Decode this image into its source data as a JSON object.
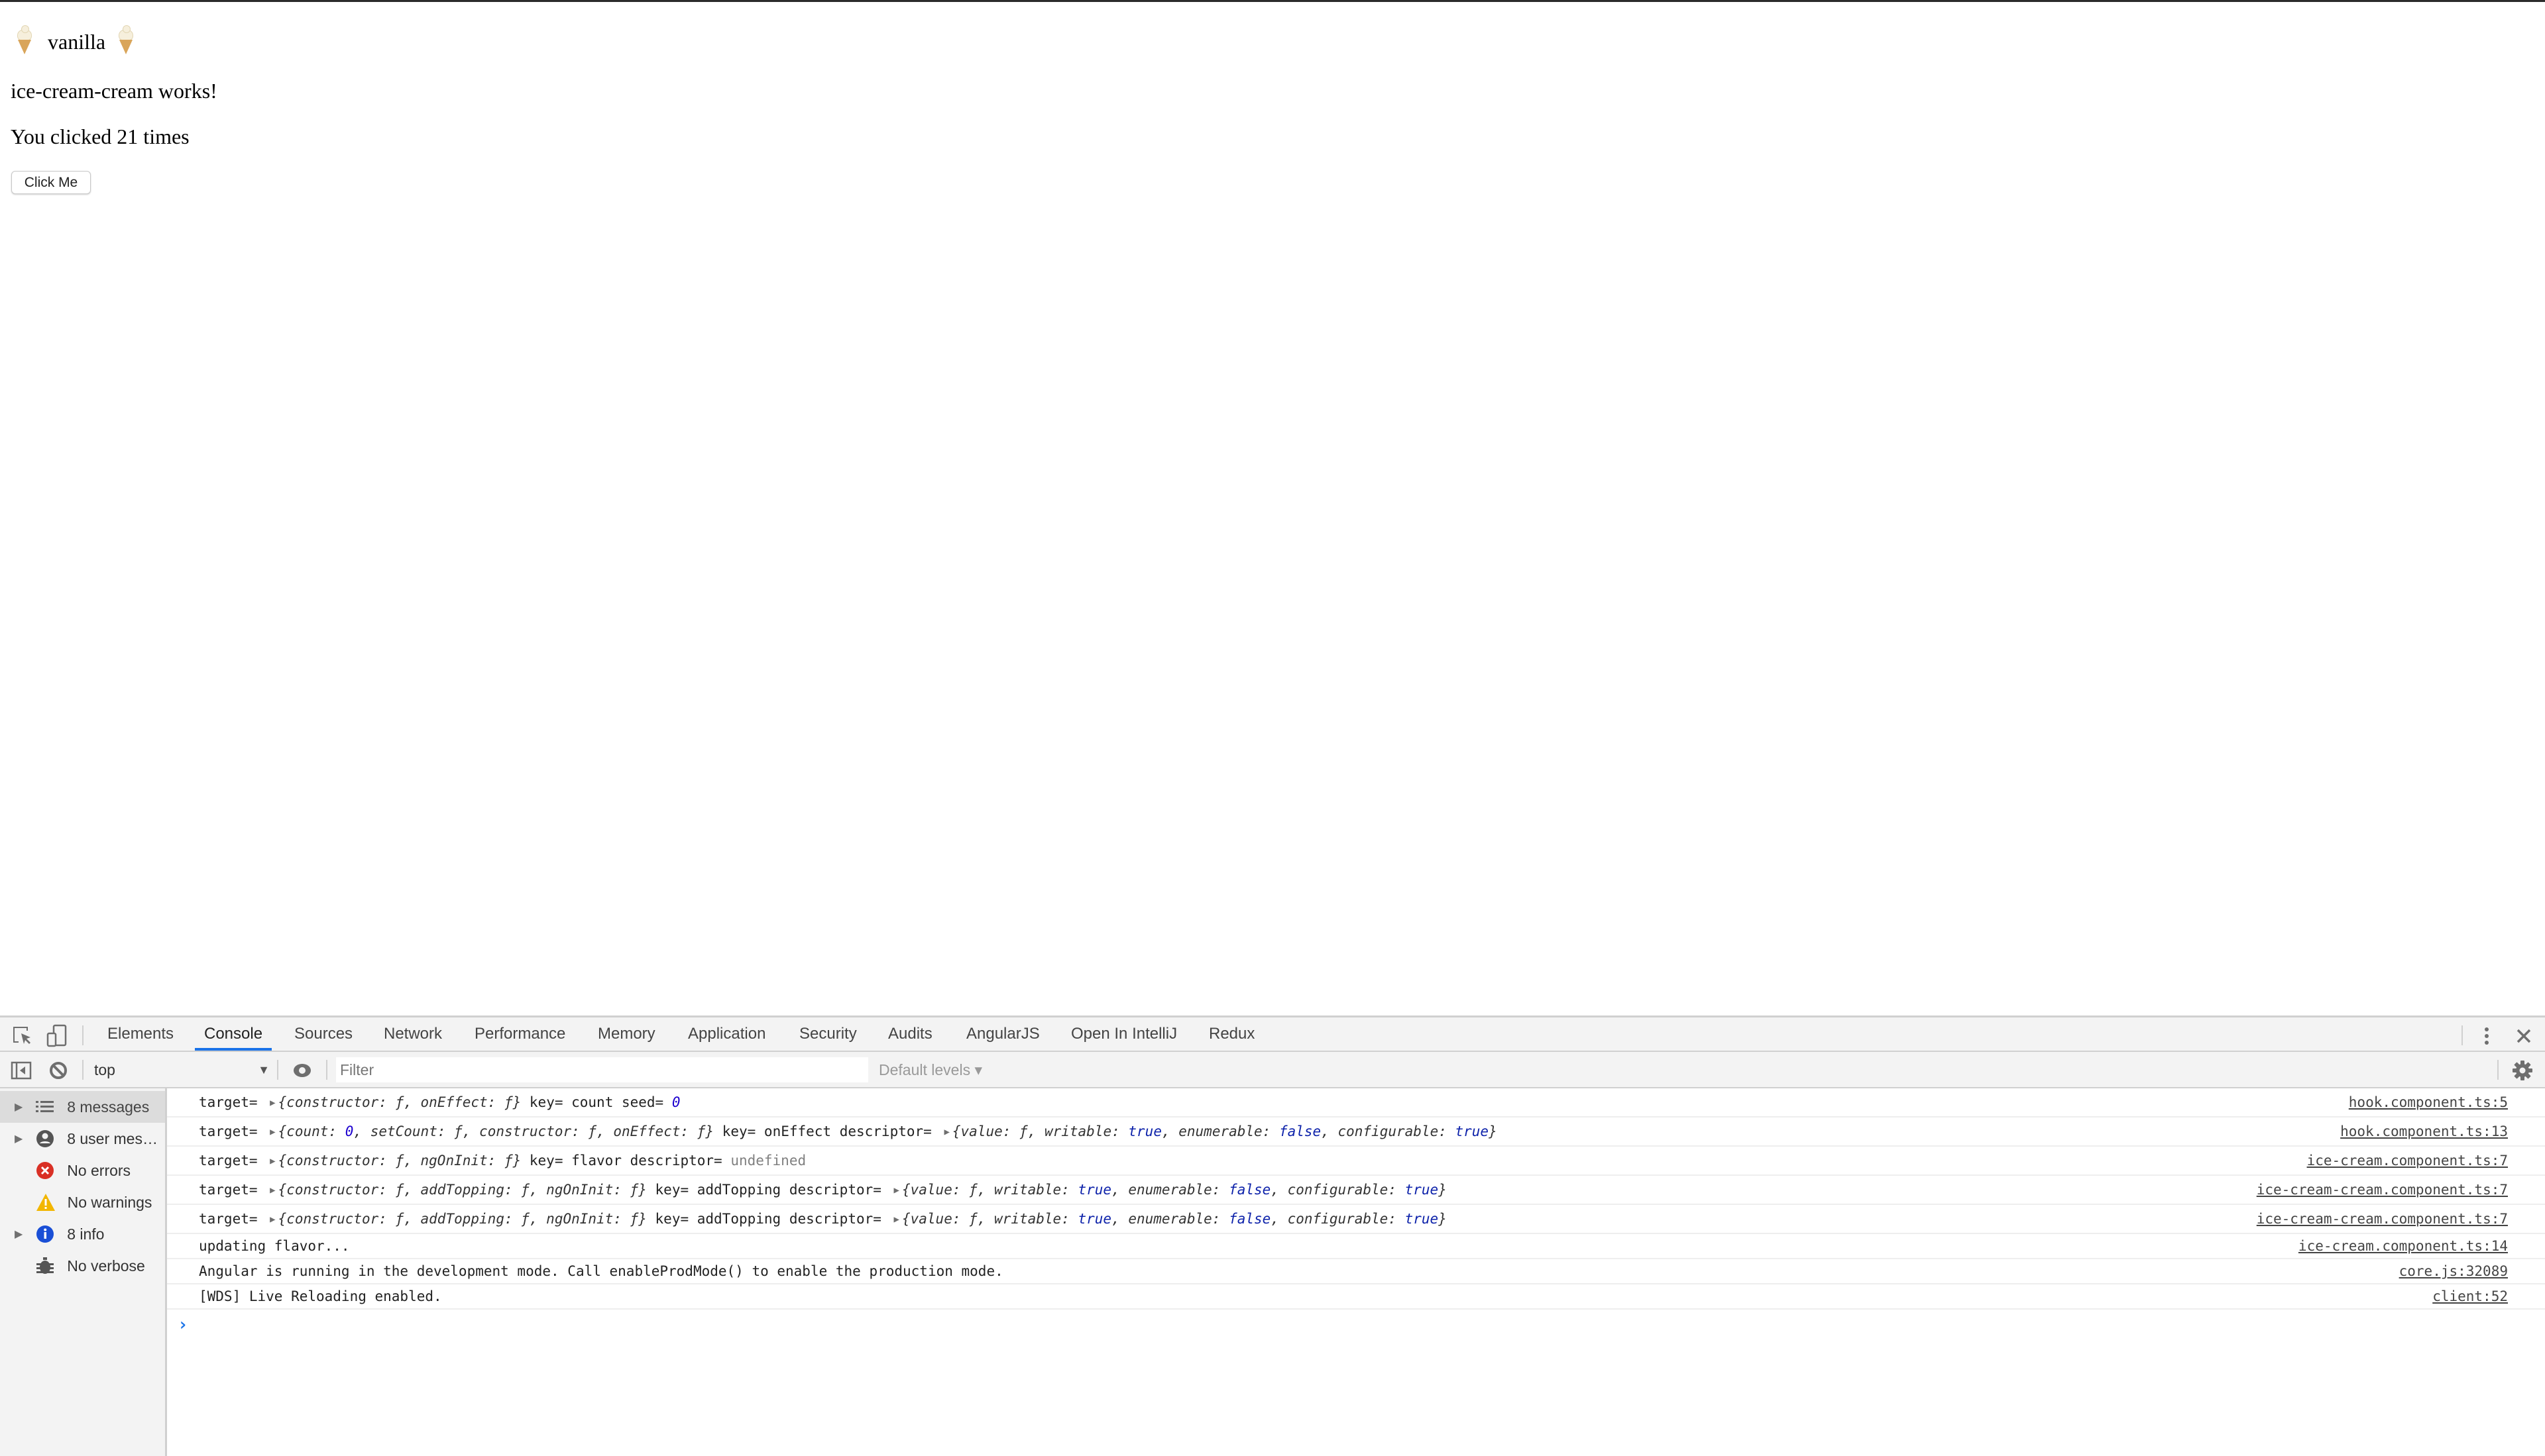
{
  "page": {
    "flavor": "vanilla",
    "flavor_icon": "soft-ice-cream-icon",
    "works_text": "ice-cream-cream works!",
    "clicked_text": "You clicked 21 times",
    "click_count": 21,
    "button_label": "Click Me"
  },
  "devtools": {
    "tabs": [
      {
        "label": "Elements",
        "active": false
      },
      {
        "label": "Console",
        "active": true
      },
      {
        "label": "Sources",
        "active": false
      },
      {
        "label": "Network",
        "active": false
      },
      {
        "label": "Performance",
        "active": false
      },
      {
        "label": "Memory",
        "active": false
      },
      {
        "label": "Application",
        "active": false
      },
      {
        "label": "Security",
        "active": false
      },
      {
        "label": "Audits",
        "active": false
      },
      {
        "label": "AngularJS",
        "active": false
      },
      {
        "label": "Open In IntelliJ",
        "active": false
      },
      {
        "label": "Redux",
        "active": false
      }
    ],
    "icons": {
      "inspect": "inspect-element-icon",
      "device": "device-toolbar-icon",
      "more": "more-vertical-icon",
      "close": "close-icon",
      "sidebar_toggle": "sidebar-toggle-icon",
      "clear": "clear-console-icon",
      "eye": "live-expression-eye-icon",
      "settings": "gear-icon"
    },
    "toolbar": {
      "context": "top",
      "filter_placeholder": "Filter",
      "filter_value": "",
      "levels": "Default levels ▾"
    },
    "sidebar": [
      {
        "label": "8 messages",
        "icon": "list-icon",
        "expandable": true,
        "selected": true
      },
      {
        "label": "8 user mes…",
        "icon": "user-icon",
        "expandable": true,
        "selected": false
      },
      {
        "label": "No errors",
        "icon": "error-icon",
        "expandable": false,
        "selected": false
      },
      {
        "label": "No warnings",
        "icon": "warning-icon",
        "expandable": false,
        "selected": false
      },
      {
        "label": "8 info",
        "icon": "info-icon",
        "expandable": true,
        "selected": false
      },
      {
        "label": "No verbose",
        "icon": "bug-icon",
        "expandable": false,
        "selected": false
      }
    ],
    "messages": [
      {
        "parts": [
          {
            "t": "target= "
          },
          {
            "tri": true
          },
          {
            "t": "{",
            "c": "it"
          },
          {
            "t": "constructor: ƒ, onEffect: ƒ}",
            "c": "it"
          },
          {
            "t": " key= count seed= "
          },
          {
            "t": "0",
            "c": "num"
          }
        ],
        "source": "hook.component.ts:5"
      },
      {
        "parts": [
          {
            "t": "target= "
          },
          {
            "tri": true
          },
          {
            "t": "{count: ",
            "c": "it"
          },
          {
            "t": "0",
            "c": "num"
          },
          {
            "t": ", setCount: ƒ, constructor: ƒ, onEffect: ƒ}",
            "c": "it"
          },
          {
            "t": " key= onEffect descriptor= "
          },
          {
            "tri": true
          },
          {
            "t": "{value: ƒ, writable: ",
            "c": "it"
          },
          {
            "t": "true",
            "c": "bool"
          },
          {
            "t": ", enumerable: ",
            "c": "it"
          },
          {
            "t": "false",
            "c": "bool"
          },
          {
            "t": ", configurable: ",
            "c": "it"
          },
          {
            "t": "true",
            "c": "bool"
          },
          {
            "t": "}",
            "c": "it"
          }
        ],
        "source": "hook.component.ts:13"
      },
      {
        "parts": [
          {
            "t": "target= "
          },
          {
            "tri": true
          },
          {
            "t": "{constructor: ƒ, ngOnInit: ƒ}",
            "c": "it"
          },
          {
            "t": " key= flavor descriptor= "
          },
          {
            "t": "undefined",
            "c": "undef"
          }
        ],
        "source": "ice-cream.component.ts:7"
      },
      {
        "parts": [
          {
            "t": "target= "
          },
          {
            "tri": true
          },
          {
            "t": "{constructor: ƒ, addTopping: ƒ, ngOnInit: ƒ}",
            "c": "it"
          },
          {
            "t": " key= addTopping descriptor= "
          },
          {
            "tri": true
          },
          {
            "t": "{value: ƒ, writable: ",
            "c": "it"
          },
          {
            "t": "true",
            "c": "bool"
          },
          {
            "t": ", enumerable: ",
            "c": "it"
          },
          {
            "t": "false",
            "c": "bool"
          },
          {
            "t": ", configurable: ",
            "c": "it"
          },
          {
            "t": "true",
            "c": "bool"
          },
          {
            "t": "}",
            "c": "it"
          }
        ],
        "source": "ice-cream-cream.component.ts:7"
      },
      {
        "parts": [
          {
            "t": "target= "
          },
          {
            "tri": true
          },
          {
            "t": "{constructor: ƒ, addTopping: ƒ, ngOnInit: ƒ}",
            "c": "it"
          },
          {
            "t": " key= addTopping descriptor= "
          },
          {
            "tri": true
          },
          {
            "t": "{value: ƒ, writable: ",
            "c": "it"
          },
          {
            "t": "true",
            "c": "bool"
          },
          {
            "t": ", enumerable: ",
            "c": "it"
          },
          {
            "t": "false",
            "c": "bool"
          },
          {
            "t": ", configurable: ",
            "c": "it"
          },
          {
            "t": "true",
            "c": "bool"
          },
          {
            "t": "}",
            "c": "it"
          }
        ],
        "source": "ice-cream-cream.component.ts:7"
      },
      {
        "parts": [
          {
            "t": "updating flavor..."
          }
        ],
        "source": "ice-cream.component.ts:14"
      },
      {
        "parts": [
          {
            "t": "Angular is running in the development mode. Call enableProdMode() to enable the production mode."
          }
        ],
        "source": "core.js:32089"
      },
      {
        "parts": [
          {
            "t": "[WDS] Live Reloading enabled."
          }
        ],
        "source": "client:52"
      }
    ],
    "prompt_symbol": "›",
    "colors": {
      "active_tab_underline": "#1a73e8",
      "number_literal": "#1c00cf",
      "boolean_literal": "#0d22aa",
      "undefined_literal": "#808080",
      "error_icon": "#d93025",
      "warning_icon": "#f2b600",
      "info_icon": "#1a4fd6"
    }
  }
}
